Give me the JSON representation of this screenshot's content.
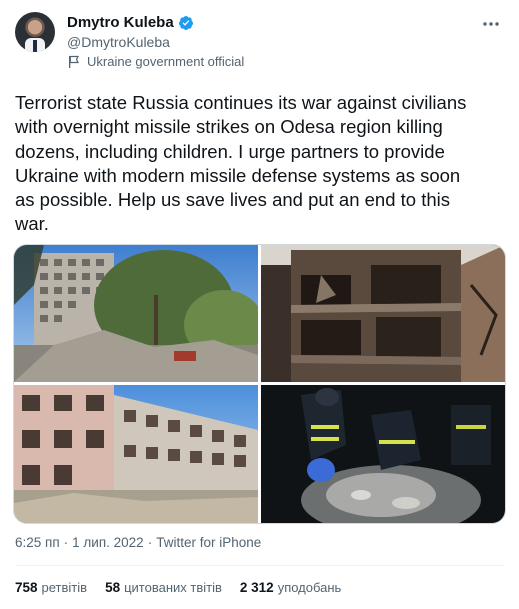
{
  "author": {
    "display_name": "Dmytro Kuleba",
    "handle": "@DmytroKuleba",
    "label": "Ukraine government official",
    "verified_color": "#1d9bf0"
  },
  "tweet": {
    "text": "Terrorist state Russia continues its war against civilians\nwith overnight missile strikes on Odesa region killing\ndozens, including children. I urge partners to provide\nUkraine with modern missile defense systems as soon\nas possible. Help us save lives and put an end to this\nwar."
  },
  "meta": {
    "time": "6:25 пп",
    "separator1": "·",
    "date": "1 лип. 2022",
    "separator2": "·",
    "source": "Twitter for iPhone"
  },
  "stats": {
    "retweets_count": "758",
    "retweets_label": "ретвітів",
    "quotes_count": "58",
    "quotes_label": "цитованих твітів",
    "likes_count": "2 312",
    "likes_label": "уподобань"
  },
  "icons": {
    "verified": "verified-badge-icon",
    "label": "flag-icon",
    "more": "more-options-icon"
  },
  "colors": {
    "text_primary": "#0f1419",
    "text_secondary": "#536471",
    "accent": "#1d9bf0",
    "divider": "#eff3f4"
  }
}
